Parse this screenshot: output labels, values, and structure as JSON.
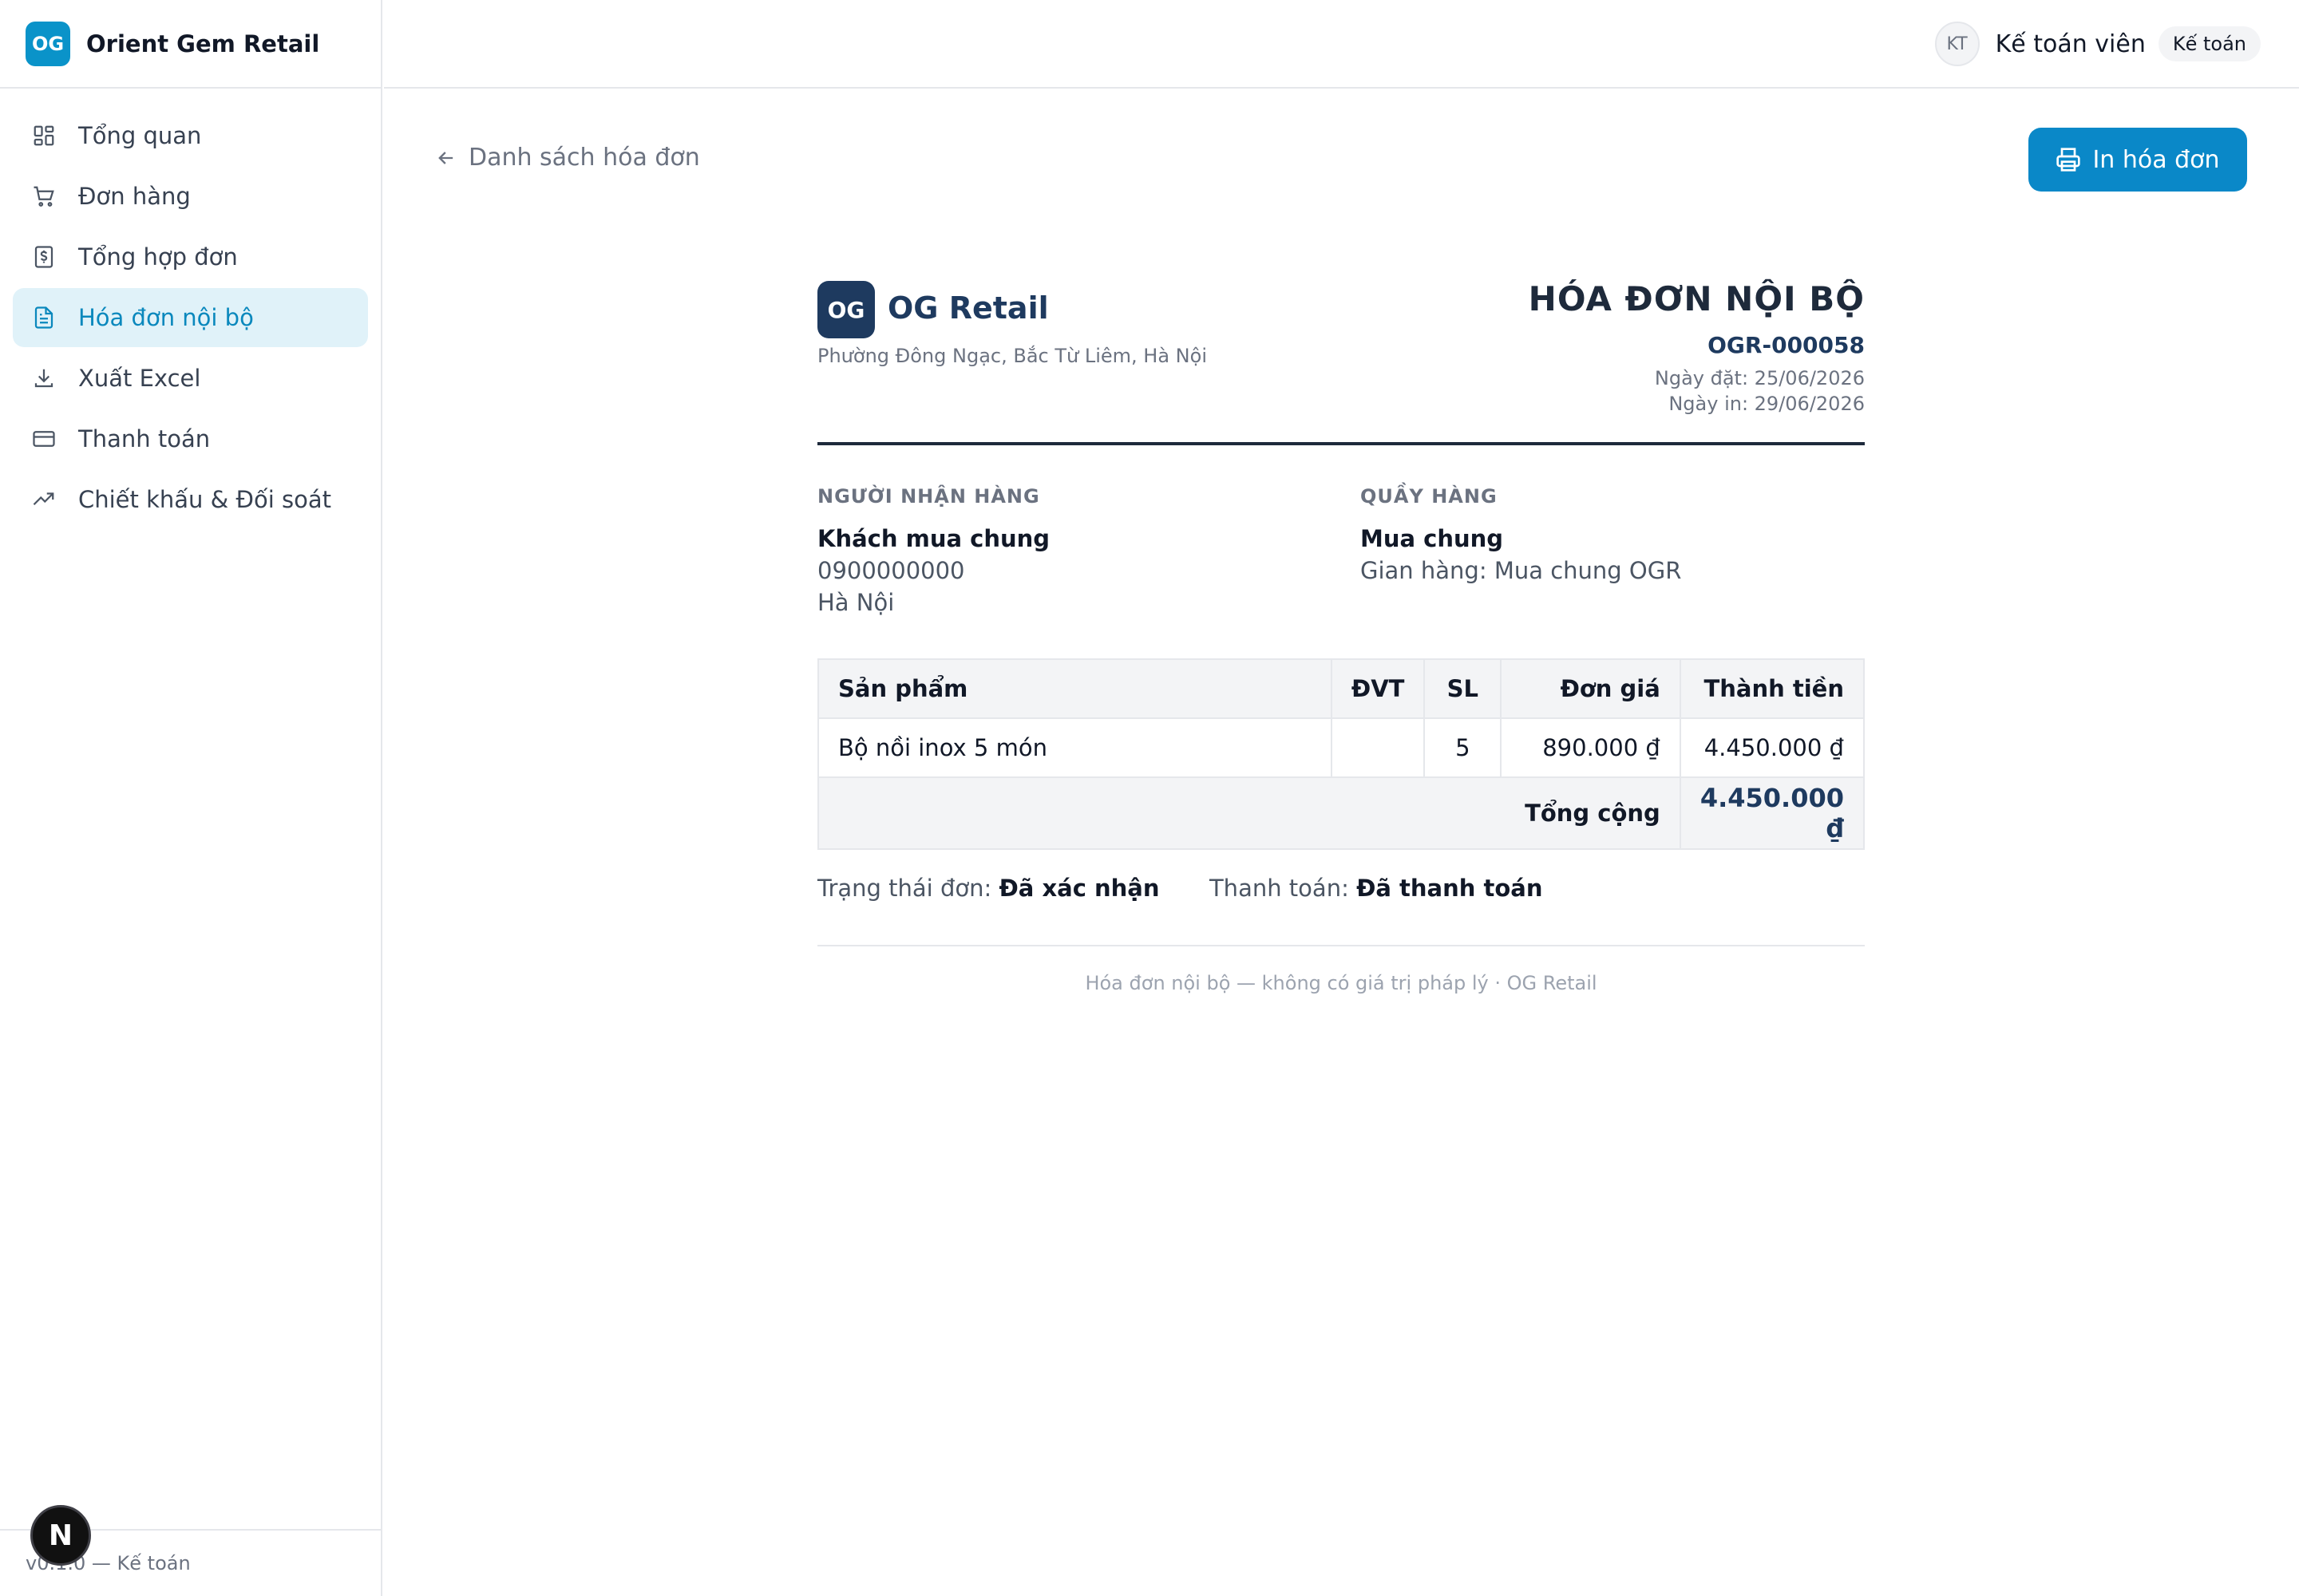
{
  "brand": {
    "logo_text": "OG",
    "name": "Orient Gem Retail"
  },
  "sidebar": {
    "items": [
      {
        "label": "Tổng quan",
        "icon": "dashboard-icon"
      },
      {
        "label": "Đơn hàng",
        "icon": "cart-icon"
      },
      {
        "label": "Tổng hợp đơn",
        "icon": "receipt-icon"
      },
      {
        "label": "Hóa đơn nội bộ",
        "icon": "document-icon",
        "active": true
      },
      {
        "label": "Xuất Excel",
        "icon": "download-icon"
      },
      {
        "label": "Thanh toán",
        "icon": "card-icon"
      },
      {
        "label": "Chiết khấu & Đối soát",
        "icon": "trend-icon"
      }
    ],
    "footer": "v0.1.0 — Kế toán"
  },
  "header": {
    "avatar": "KT",
    "user_name": "Kế toán viên",
    "role": "Kế toán"
  },
  "toolbar": {
    "back_label": "Danh sách hóa đơn",
    "print_label": "In hóa đơn"
  },
  "invoice": {
    "logo_text": "OG",
    "company": "OG Retail",
    "address": "Phường Đông Ngạc, Bắc Từ Liêm, Hà Nội",
    "title": "HÓA ĐƠN NỘI BỘ",
    "code": "OGR-000058",
    "order_date": "Ngày đặt: 25/06/2026",
    "print_date": "Ngày in: 29/06/2026",
    "recipient": {
      "label": "NGƯỜI NHẬN HÀNG",
      "name": "Khách mua chung",
      "phone": "0900000000",
      "address": "Hà Nội"
    },
    "counter": {
      "label": "QUẦY HÀNG",
      "name": "Mua chung",
      "stall": "Gian hàng: Mua chung OGR"
    },
    "table": {
      "headers": [
        "Sản phẩm",
        "ĐVT",
        "SL",
        "Đơn giá",
        "Thành tiền"
      ],
      "rows": [
        {
          "product": "Bộ nồi inox 5 món",
          "unit": "",
          "qty": "5",
          "price": "890.000 ₫",
          "amount": "4.450.000 ₫"
        }
      ],
      "total_label": "Tổng cộng",
      "total_value": "4.450.000 ₫"
    },
    "status": {
      "order_label": "Trạng thái đơn:",
      "order_value": "Đã xác nhận",
      "payment_label": "Thanh toán:",
      "payment_value": "Đã thanh toán"
    },
    "footnote": "Hóa đơn nội bộ — không có giá trị pháp lý · OG Retail"
  },
  "colors": {
    "accent": "#0a88c8",
    "navy": "#1e3a5f",
    "active_bg": "#e0f2f9"
  }
}
